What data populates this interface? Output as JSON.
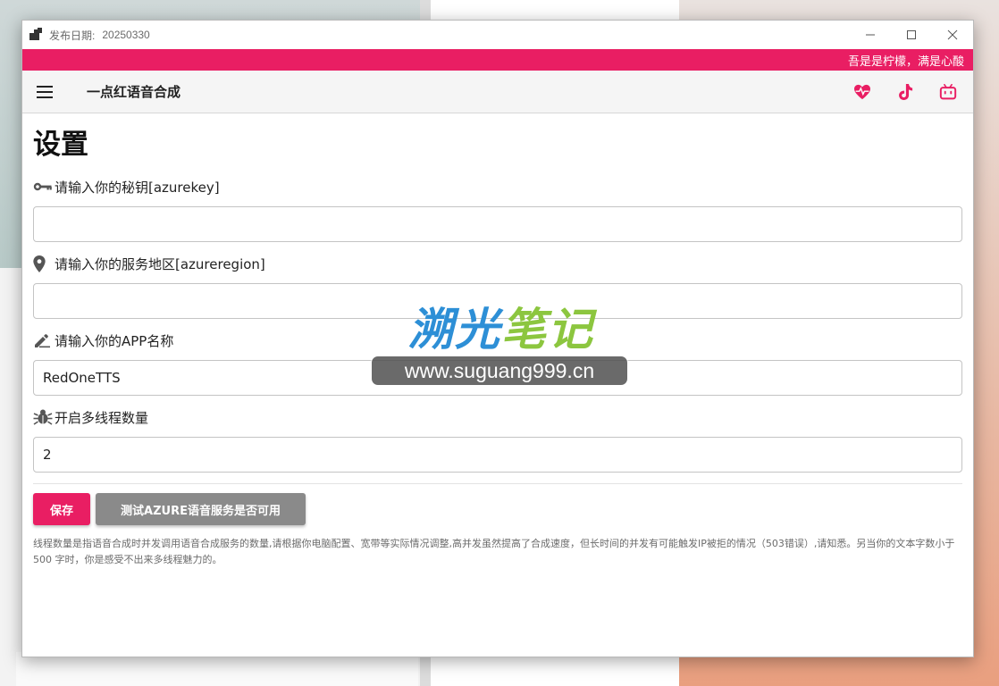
{
  "window": {
    "title_label": "发布日期:",
    "title_value": "20250330"
  },
  "marquee": {
    "text": "吾是是柠檬，满是心酸"
  },
  "appbar": {
    "title": "一点红语音合成",
    "icons": [
      "heartbeat-icon",
      "tiktok-icon",
      "bilibili-icon"
    ],
    "accent": "#e91e63"
  },
  "settings": {
    "page_title": "设置",
    "fields": [
      {
        "label": "请输入你的秘钥[azurekey]",
        "value": "",
        "icon": "key-icon"
      },
      {
        "label": "请输入你的服务地区[azureregion]",
        "value": "",
        "icon": "location-pin-icon"
      },
      {
        "label": "请输入你的APP名称",
        "value": "RedOneTTS",
        "icon": "pencil-icon"
      },
      {
        "label": "开启多线程数量",
        "value": "2",
        "icon": "bug-icon"
      }
    ],
    "save_label": "保存",
    "test_label": "测试AZURE语音服务是否可用",
    "note": "线程数量是指语音合成时并发调用语音合成服务的数量,请根据你电脑配置、宽带等实际情况调整,高并发虽然提高了合成速度，但长时间的并发有可能触发IP被拒的情况（503错误）,请知悉。另当你的文本字数小于500 字时，你是感受不出来多线程魅力的。"
  },
  "watermark": {
    "title_blue": "溯光",
    "title_green": "笔记",
    "url": "www.suguang999.cn"
  }
}
